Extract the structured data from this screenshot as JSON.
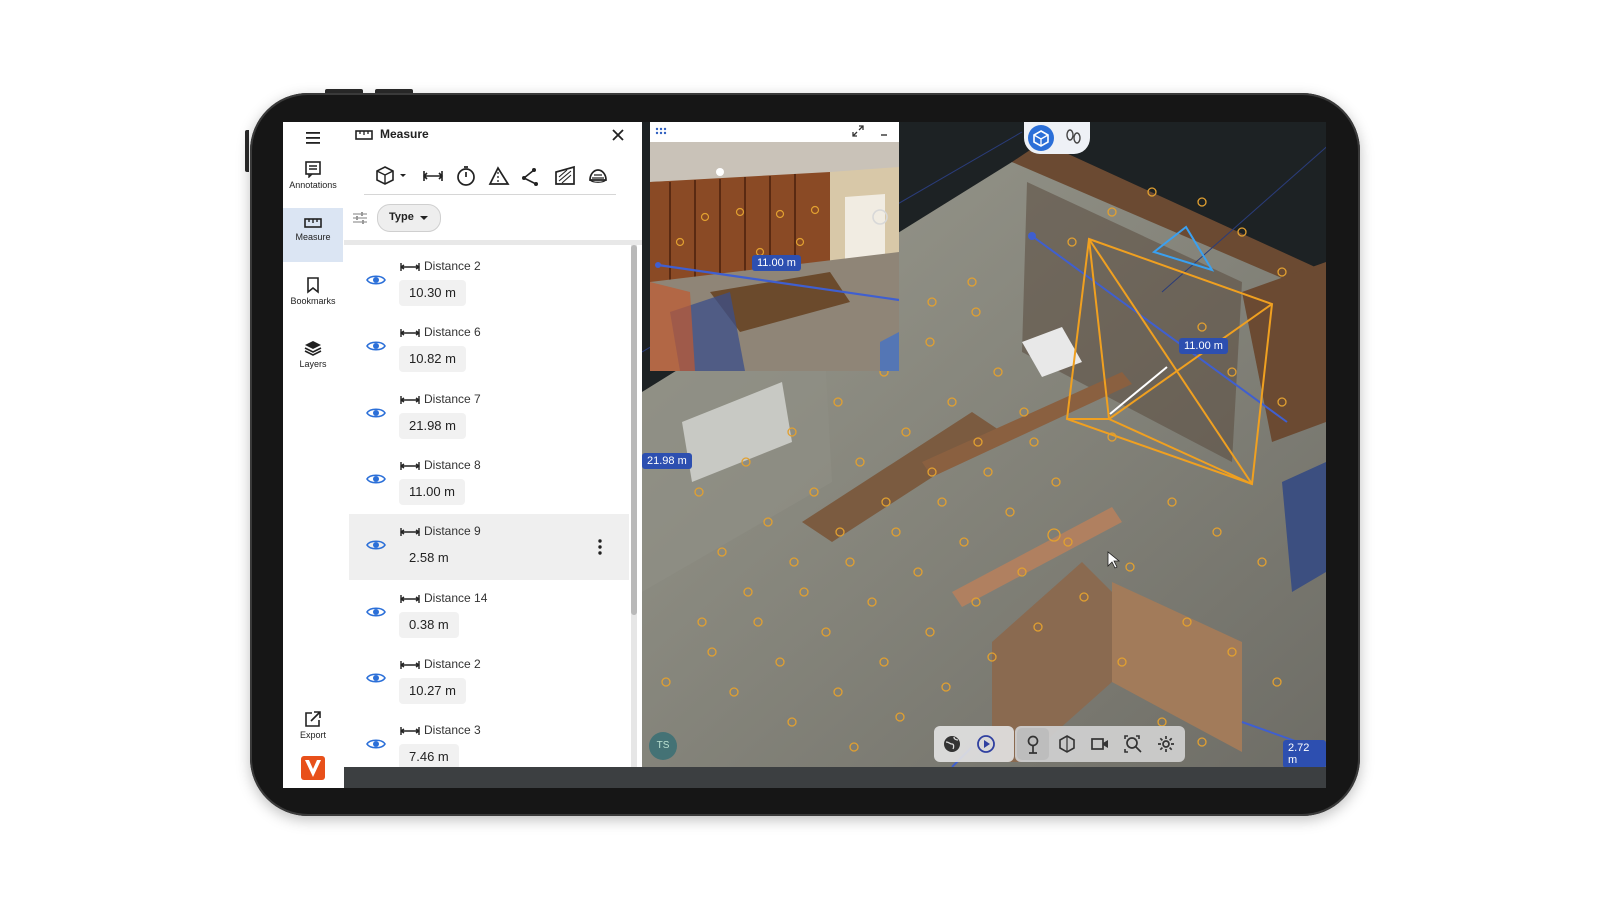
{
  "panel": {
    "title": "Measure",
    "filter_label": "Type"
  },
  "rail": [
    {
      "label": "Annotations",
      "icon": "annotations-icon"
    },
    {
      "label": "Measure",
      "icon": "ruler-icon"
    },
    {
      "label": "Bookmarks",
      "icon": "bookmark-icon"
    },
    {
      "label": "Layers",
      "icon": "layers-icon"
    }
  ],
  "export_label": "Export",
  "measurements": [
    {
      "name": "Distance 2",
      "value": "10.30 m"
    },
    {
      "name": "Distance 6",
      "value": "10.82 m"
    },
    {
      "name": "Distance 7",
      "value": "21.98 m"
    },
    {
      "name": "Distance 8",
      "value": "11.00 m"
    },
    {
      "name": "Distance 9",
      "value": "2.58 m",
      "selected": true
    },
    {
      "name": "Distance 14",
      "value": "0.38 m"
    },
    {
      "name": "Distance 2",
      "value": "10.27 m"
    },
    {
      "name": "Distance 3",
      "value": "7.46 m"
    }
  ],
  "viewer": {
    "labels": {
      "main": "11.00 m",
      "left": "21.98 m",
      "right": "2.72 m"
    },
    "pano_label": "11.00 m",
    "avatar_initials": "TS"
  },
  "colors": {
    "accent": "#2d4fb0",
    "selection_frame": "#f0a020",
    "brand": "#e8501a",
    "active_rail": "#dbe5f3"
  }
}
